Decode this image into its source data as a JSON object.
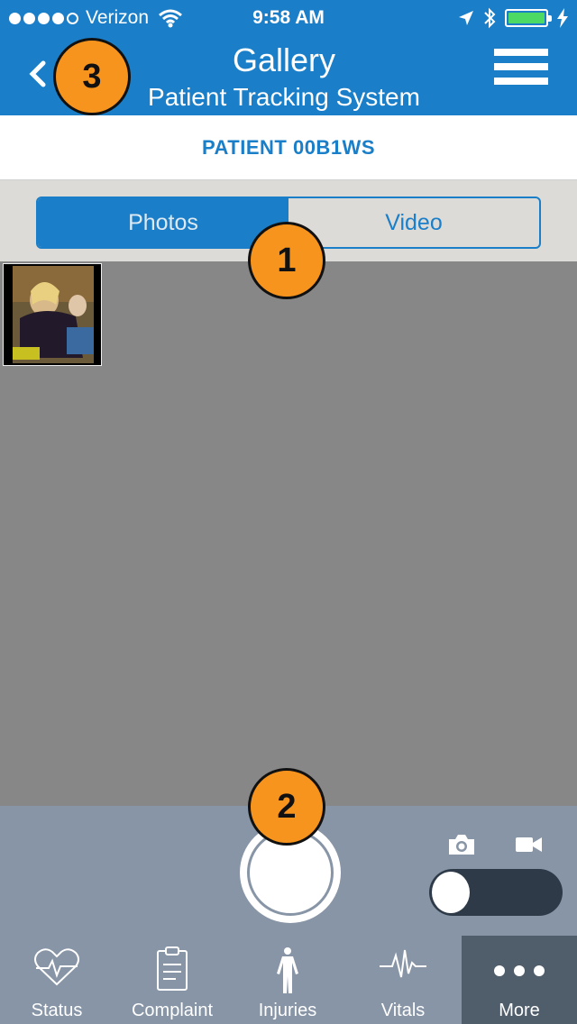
{
  "status_bar": {
    "carrier": "Verizon",
    "time": "9:58 AM"
  },
  "nav": {
    "title": "Gallery",
    "subtitle": "Patient Tracking System"
  },
  "patient": {
    "label": "PATIENT 00B1WS"
  },
  "segments": [
    {
      "label": "Photos",
      "active": true
    },
    {
      "label": "Video",
      "active": false
    }
  ],
  "tabs": [
    {
      "label": "Status",
      "icon": "heart-pulse-icon"
    },
    {
      "label": "Complaint",
      "icon": "clipboard-icon"
    },
    {
      "label": "Injuries",
      "icon": "body-icon"
    },
    {
      "label": "Vitals",
      "icon": "pulse-icon"
    },
    {
      "label": "More",
      "icon": "more-dots-icon"
    }
  ],
  "annotations": [
    "1",
    "2",
    "3"
  ],
  "colors": {
    "primary": "#1a7fc8",
    "toolbar": "#8795a6",
    "badge": "#f7941d"
  }
}
